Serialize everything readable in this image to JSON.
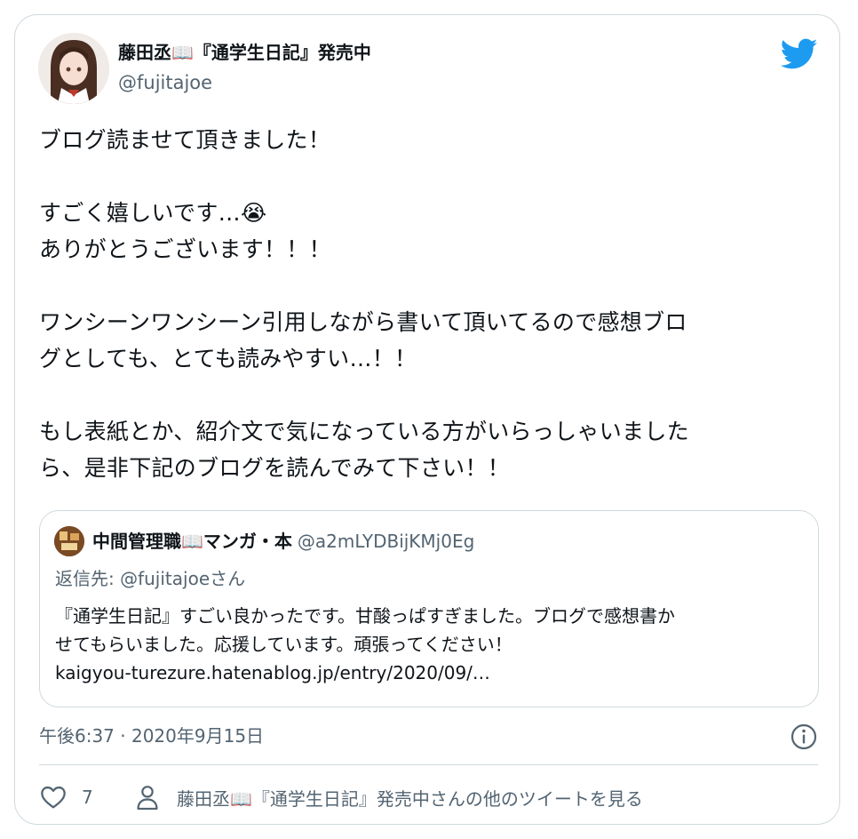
{
  "tweet": {
    "author": {
      "name": "藤田丞📖『通学生日記』発売中",
      "handle": "@fujitajoe"
    },
    "text_lines": [
      "ブログ読ませて頂きました！",
      "",
      "すごく嬉しいです…😭",
      "ありがとうございます！！！",
      "",
      "ワンシーンワンシーン引用しながら書いて頂いてるので感想ブロ",
      "グとしても、とても読みやすい…！！",
      "",
      "もし表紙とか、紹介文で気になっている方がいらっしゃいました",
      "ら、是非下記のブログを読んでみて下さい！！"
    ],
    "timestamp": "午後6:37 · 2020年9月15日",
    "like_count": "7",
    "more_link": "藤田丞📖『通学生日記』発売中さんの他のツイートを見る"
  },
  "quote": {
    "name": "中間管理職📖マンガ・本",
    "handle": "@a2mLYDBijKMj0Eg",
    "reply_to": "返信先: @fujitajoeさん",
    "text_lines": [
      "『通学生日記』すごい良かったです。甘酸っぱすぎました。ブログで感想書か",
      "せてもらいました。応援しています。頑張ってください！",
      "kaigyou-turezure.hatenablog.jp/entry/2020/09/…"
    ]
  },
  "colors": {
    "twitter_blue": "#1d9bf0",
    "secondary_text": "#536471",
    "border": "#cfd9de"
  },
  "icons": [
    "twitter-bird-icon",
    "info-icon",
    "heart-icon",
    "person-icon"
  ]
}
